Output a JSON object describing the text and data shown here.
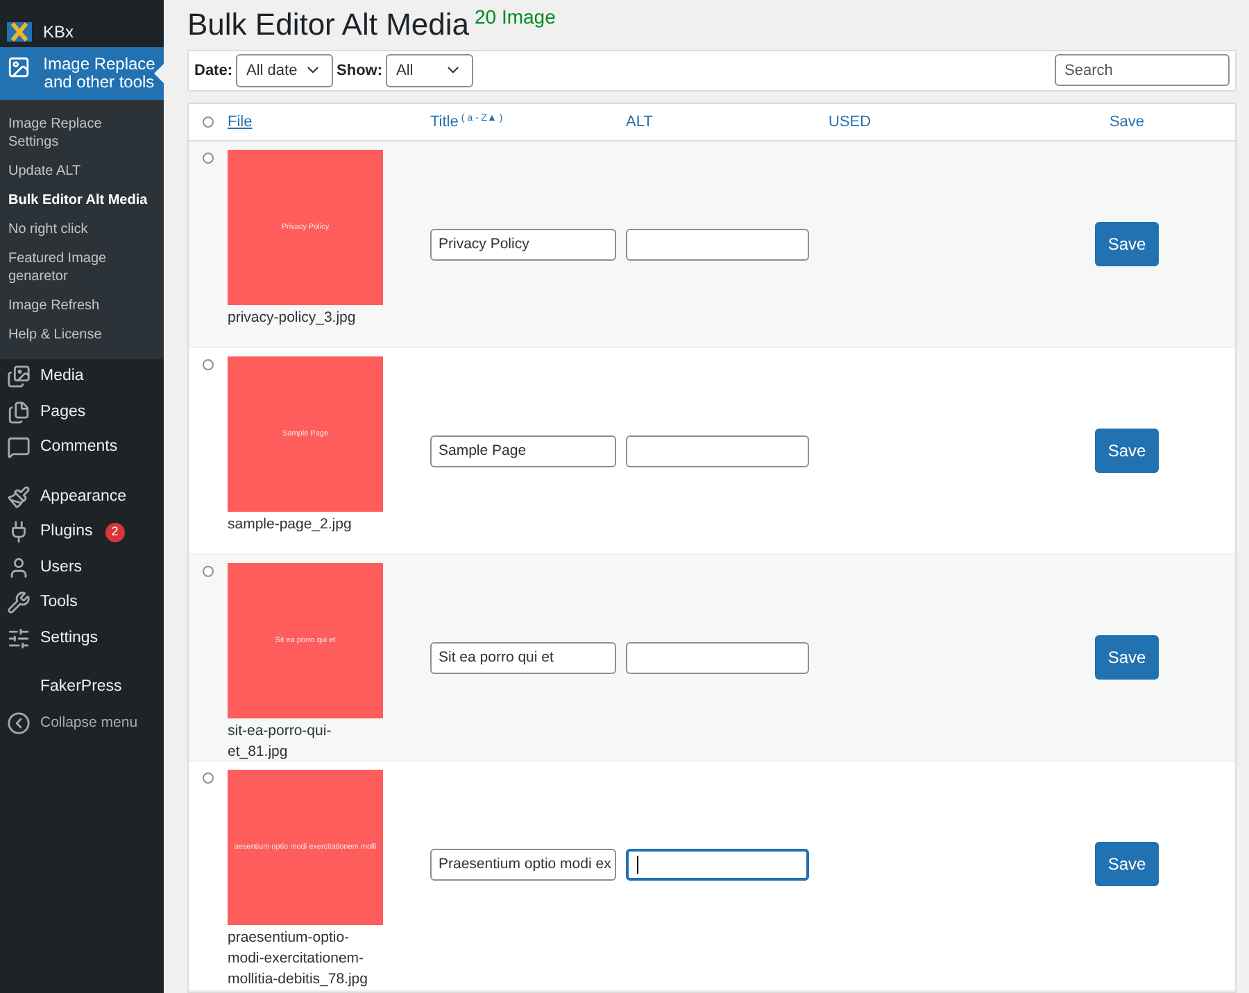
{
  "sidebar": {
    "items": [
      {
        "kind": "plugin",
        "label": "KBx",
        "selected": false
      },
      {
        "kind": "current",
        "label": "Image Replace and other tools",
        "selected": true,
        "submenu": [
          {
            "label": "Image Replace Settings",
            "selected": false
          },
          {
            "label": "Update ALT",
            "selected": false
          },
          {
            "label": "Bulk Editor Alt Media",
            "selected": true
          },
          {
            "label": "No right click",
            "selected": false
          },
          {
            "label": "Featured Image genaretor",
            "selected": false
          },
          {
            "label": "Image Refresh",
            "selected": false
          },
          {
            "label": "Help & License",
            "selected": false
          }
        ]
      },
      {
        "kind": "menu",
        "label": "Media",
        "selected": false
      },
      {
        "kind": "menu",
        "label": "Pages",
        "selected": false
      },
      {
        "kind": "menu",
        "label": "Comments",
        "selected": false
      },
      {
        "kind": "gap"
      },
      {
        "kind": "menu",
        "label": "Appearance",
        "selected": false
      },
      {
        "kind": "menu",
        "label": "Plugins",
        "badge": "2",
        "selected": false
      },
      {
        "kind": "menu",
        "label": "Users",
        "selected": false
      },
      {
        "kind": "menu",
        "label": "Tools",
        "selected": false
      },
      {
        "kind": "menu",
        "label": "Settings",
        "selected": false
      },
      {
        "kind": "gap"
      },
      {
        "kind": "menu",
        "label": "FakerPress",
        "selected": false
      },
      {
        "kind": "collapse",
        "label": "Collapse menu",
        "selected": false
      }
    ]
  },
  "page": {
    "title": "Bulk Editor Alt Media",
    "count": "20 Image"
  },
  "filters": {
    "date_label": "Date:",
    "date_value": "All date",
    "show_label": "Show:",
    "show_value": "All",
    "search": {
      "placeholder": "Search"
    }
  },
  "table": {
    "select_all_selected": false,
    "columns": [
      {
        "label": "File",
        "underlined": true
      },
      {
        "label": "Title",
        "underlined": false,
        "sort": "( a - Z▲ )"
      },
      {
        "label": "ALT",
        "underlined": false
      },
      {
        "label": "USED",
        "underlined": false
      },
      {
        "label": "Save",
        "underlined": false
      }
    ],
    "rows": [
      {
        "selected": false,
        "thumb_text": "Privacy Policy",
        "file": "privacy-policy_3.jpg",
        "title": "Privacy Policy",
        "focused": false,
        "button": "Save"
      },
      {
        "selected": false,
        "thumb_text": "Sample Page",
        "file": "sample-page_2.jpg",
        "title": "Sample Page",
        "focused": false,
        "button": "Save"
      },
      {
        "selected": false,
        "thumb_text": "Sit ea porro qui et",
        "file": "sit-ea-porro-qui-et_81.jpg",
        "title": "Sit ea porro qui et",
        "focused": false,
        "button": "Save"
      },
      {
        "selected": false,
        "thumb_text": "aesentium optio modi exercitationem molli",
        "file": "praesentium-optio-modi-exercitationem-mollitia-debitis_78.jpg",
        "title": "Praesentium optio modi ex",
        "focused": true,
        "button": "Save"
      }
    ]
  }
}
